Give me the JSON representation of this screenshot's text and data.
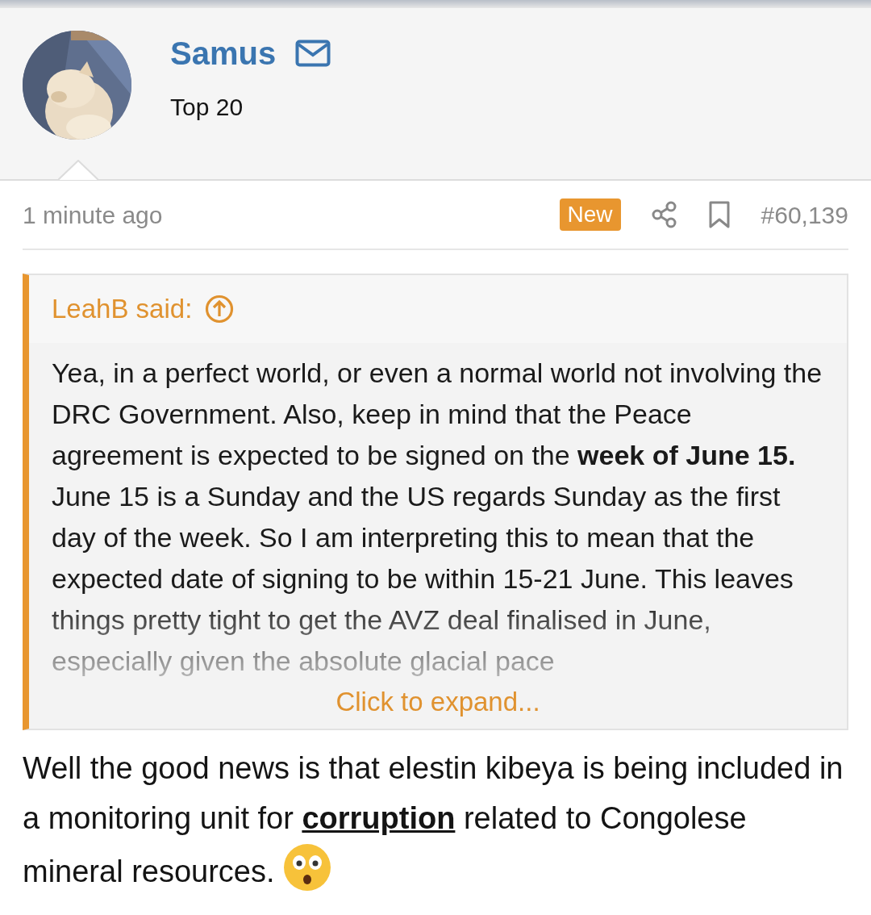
{
  "post": {
    "author": {
      "name": "Samus",
      "title": "Top 20"
    },
    "time": "1 minute ago",
    "badge": "New",
    "number": "#60,139",
    "quote": {
      "author_label": "LeahB said:",
      "text": "Yea, in a perfect world, or even a normal world not involving the DRC Government. Also, keep in mind that the Peace agreement is expected to be signed on the **week of June 15.** June 15 is a Sunday and the US regards Sunday as the first day of the week. So I am interpreting this to mean that the expected date of signing to be within 15-21 June. This leaves things pretty tight to get the AVZ deal finalised in June, especially given the absolute glacial pace",
      "expand_label": "Click to expand..."
    },
    "body": {
      "before": "Well the good news is that elestin kibeya is being included in a monitoring unit for ",
      "link": "corruption",
      "after": " related to Congolese mineral resources."
    }
  }
}
